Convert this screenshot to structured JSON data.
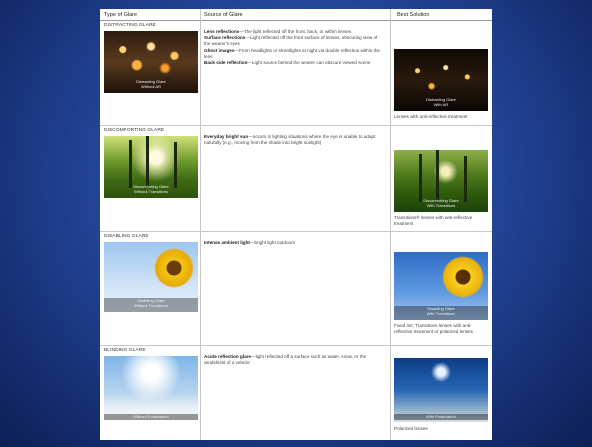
{
  "header": {
    "type_label": "Type of Glare",
    "source_label": "Source of Glare",
    "solution_label": "Best Solution"
  },
  "rows": [
    {
      "title": "DISTRACTING GLARE",
      "img_caption": "Distracting Glare\nWithout AR",
      "source_lines": [
        {
          "bold": "Lens reflections",
          "text": "—The light reflected off the front, back, or within lenses"
        },
        {
          "bold": "Surface reflections",
          "text": "—Light reflected off the front surface of lenses, obscuring view of the wearer's eyes"
        },
        {
          "bold": "Ghost images",
          "text": "—From headlights or streetlights at night via double reflection within the lens"
        },
        {
          "bold": "Back side reflection",
          "text": "—Light source behind the wearer can obscure viewed scene"
        }
      ],
      "solution_caption": "Distracting Glare\nWith AR",
      "solution_text": "Lenses with anti-reflective treatment"
    },
    {
      "title": "DISCOMFORTING GLARE",
      "img_caption": "Discomforting Glare\nWithout Transitions",
      "source_lines": [
        {
          "bold": "Everyday bright sun",
          "text": "—occurs in lighting situations where the eye is unable to adapt naturally (e.g., moving from the shade into bright sunlight)"
        }
      ],
      "solution_caption": "Discomforting Glare\nWith Transitions",
      "solution_text": "Transitions® lenses with anti-reflective treatment"
    },
    {
      "title": "DISABLING GLARE",
      "img_caption": "Disabling Glare\nWithout Transitions",
      "source_lines": [
        {
          "bold": "Intense ambient light",
          "text": "—bright light outdoors"
        }
      ],
      "solution_caption": "Disabling Glare\nWith Transitions",
      "solution_text": "Fixed tint, Transitions lenses with anti-reflective treatment or polarized lenses"
    },
    {
      "title": "BLINDING GLARE",
      "img_caption": "Without Polarization",
      "source_lines": [
        {
          "bold": "Acute reflection glare",
          "text": "—light reflected off a surface such as water, snow, or the windshield of a vehicle"
        }
      ],
      "solution_caption": "With Polarization",
      "solution_text": "Polarized lenses"
    }
  ]
}
